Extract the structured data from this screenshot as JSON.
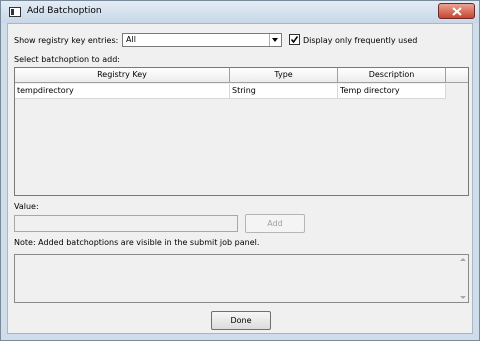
{
  "window": {
    "title": "Add Batchoption",
    "close_icon": "close-icon"
  },
  "filter": {
    "label": "Show registry key entries:",
    "selected": "All",
    "checkbox_label": "Display only frequently used",
    "checkbox_checked": true
  },
  "select_label": "Select batchoption to add:",
  "table": {
    "columns": [
      "Registry Key",
      "Type",
      "Description"
    ],
    "rows": [
      [
        "tempdirectory",
        "String",
        "Temp directory"
      ]
    ]
  },
  "value": {
    "label": "Value:",
    "current": "",
    "add_button": "Add"
  },
  "note": "Note: Added batchoptions are visible in the submit job panel.",
  "done_button": "Done"
}
